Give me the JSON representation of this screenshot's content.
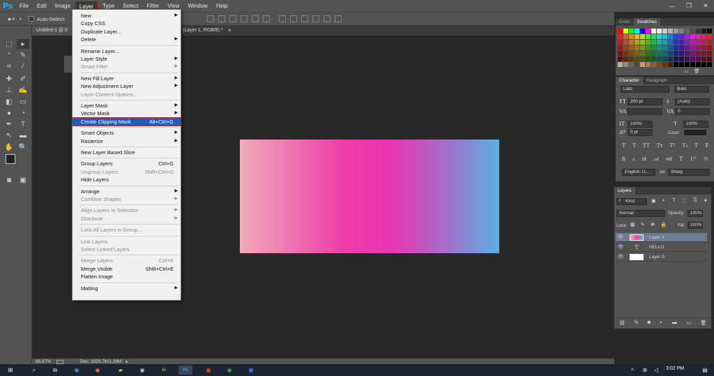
{
  "app": {
    "logo": "Ps"
  },
  "menubar": [
    "File",
    "Edit",
    "Image",
    "Layer",
    "Type",
    "Select",
    "Filter",
    "View",
    "Window",
    "Help"
  ],
  "options": {
    "auto_select": "Auto-Select:"
  },
  "doc": {
    "tab1": "Untitled-1 @ 6",
    "tab2": "(Layer 1, RGB/8) *",
    "close": "×"
  },
  "status": {
    "zoom": "66.67%",
    "doc": "Doc: 1020.7K/1.29M"
  },
  "layer_menu": {
    "items": [
      {
        "label": "New",
        "arrow": true
      },
      {
        "label": "Copy CSS"
      },
      {
        "label": "Duplicate Layer..."
      },
      {
        "label": "Delete",
        "arrow": true
      },
      {
        "sep": true
      },
      {
        "label": "Rename Layer..."
      },
      {
        "label": "Layer Style",
        "arrow": true
      },
      {
        "label": "Smart Filter",
        "disabled": true,
        "arrow": true
      },
      {
        "sep": true
      },
      {
        "label": "New Fill Layer",
        "arrow": true
      },
      {
        "label": "New Adjustment Layer",
        "arrow": true
      },
      {
        "label": "Layer Content Options...",
        "disabled": true
      },
      {
        "sep": true
      },
      {
        "label": "Layer Mask",
        "arrow": true
      },
      {
        "label": "Vector Mask",
        "arrow": true
      },
      {
        "label": "Create Clipping Mask",
        "shortcut": "Alt+Ctrl+G",
        "highlighted": true
      },
      {
        "sep": true
      },
      {
        "label": "Smart Objects",
        "arrow": true
      },
      {
        "label": "Rasterize",
        "arrow": true
      },
      {
        "sep": true
      },
      {
        "label": "New Layer Based Slice"
      },
      {
        "sep": true
      },
      {
        "label": "Group Layers",
        "shortcut": "Ctrl+G"
      },
      {
        "label": "Ungroup Layers",
        "shortcut": "Shift+Ctrl+G",
        "disabled": true
      },
      {
        "label": "Hide Layers"
      },
      {
        "sep": true
      },
      {
        "label": "Arrange",
        "arrow": true
      },
      {
        "label": "Combine Shapes",
        "disabled": true,
        "arrow": true
      },
      {
        "sep": true
      },
      {
        "label": "Align Layers to Selection",
        "disabled": true,
        "arrow": true
      },
      {
        "label": "Distribute",
        "disabled": true,
        "arrow": true
      },
      {
        "sep": true
      },
      {
        "label": "Lock All Layers in Group...",
        "disabled": true
      },
      {
        "sep": true
      },
      {
        "label": "Link Layers",
        "disabled": true
      },
      {
        "label": "Select Linked Layers",
        "disabled": true
      },
      {
        "sep": true
      },
      {
        "label": "Merge Layers",
        "shortcut": "Ctrl+E",
        "disabled": true
      },
      {
        "label": "Merge Visible",
        "shortcut": "Shift+Ctrl+E"
      },
      {
        "label": "Flatten Image"
      },
      {
        "sep": true
      },
      {
        "label": "Matting",
        "arrow": true
      }
    ]
  },
  "color_panel": {
    "tab1": "Color",
    "tab2": "Swatches"
  },
  "character": {
    "tab1": "Character",
    "tab2": "Paragraph",
    "font": "Lato",
    "style": "Bold",
    "size": "200 pt",
    "leading": "(Auto)",
    "kerning": "",
    "tracking": "0",
    "vscale": "100%",
    "hscale": "100%",
    "baseline": "0 pt",
    "color_label": "Color:",
    "language": "English: U...",
    "aa": "aa",
    "aa_mode": "Sharp"
  },
  "layers_panel": {
    "tab": "Layers",
    "kind": "Kind",
    "blend": "Normal",
    "opacity_label": "Opacity:",
    "opacity": "100%",
    "lock_label": "Lock:",
    "fill_label": "Fill:",
    "fill": "100%",
    "layers": [
      {
        "name": "Layer 1",
        "selected": true
      },
      {
        "name": "HELLO"
      },
      {
        "name": "Layer 0"
      }
    ],
    "type_glyph": "T"
  },
  "taskbar": {
    "time": "3:02 PM"
  },
  "colors": {
    "accent": "#1f5eb8",
    "highlight_border": "#c42c2c"
  }
}
